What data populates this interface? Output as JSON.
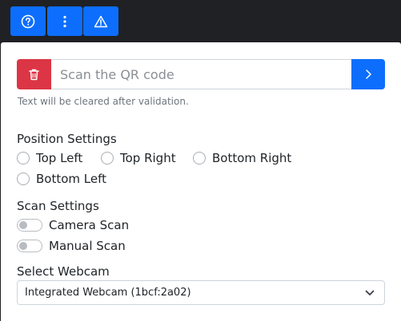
{
  "toolbar": {
    "buttons": [
      {
        "icon": "help-circle-icon"
      },
      {
        "icon": "more-vertical-icon"
      },
      {
        "icon": "warning-triangle-icon"
      }
    ]
  },
  "scan": {
    "placeholder": "Scan the QR code",
    "value": "",
    "hint": "Text will be cleared after validation.",
    "clear_icon": "trash-icon",
    "submit_icon": "chevron-right-icon"
  },
  "position_settings": {
    "label": "Position Settings",
    "options": [
      "Top Left",
      "Top Right",
      "Bottom Right",
      "Bottom Left"
    ],
    "selected": null
  },
  "scan_settings": {
    "label": "Scan Settings",
    "toggles": [
      {
        "label": "Camera Scan",
        "on": false
      },
      {
        "label": "Manual Scan",
        "on": false
      }
    ]
  },
  "webcam": {
    "label": "Select Webcam",
    "selected": "Integrated Webcam (1bcf:2a02)"
  },
  "colors": {
    "primary": "#0d6efd",
    "danger": "#dc3545",
    "topbar": "#202124"
  }
}
